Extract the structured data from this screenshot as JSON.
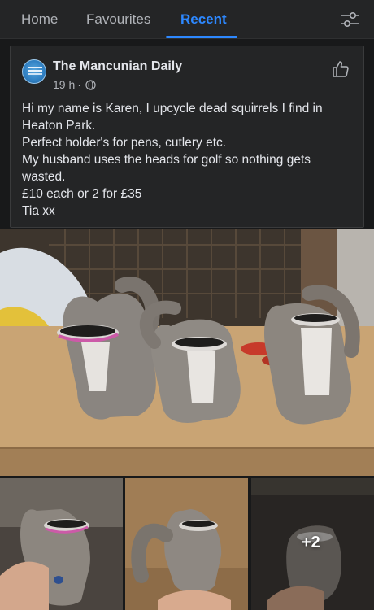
{
  "tabs": [
    {
      "label": "Home",
      "active": false
    },
    {
      "label": "Favourites",
      "active": false
    },
    {
      "label": "Recent",
      "active": true
    }
  ],
  "post": {
    "page_name": "The Mancunian Daily",
    "time": "19 h",
    "separator": "·",
    "text_lines": [
      "Hi my name is Karen, I upcycle dead squirrels I find in",
      "Heaton Park.",
      "Perfect holder's for pens, cutlery etc.",
      "My husband uses the heads for golf so nothing gets",
      "wasted.",
      "£10 each or 2 for £35",
      "Tia xx"
    ],
    "more_photos": "+2"
  },
  "icons": {
    "filter": "filter-sliders-icon",
    "like": "thumbs-up-icon",
    "audience": "globe-icon"
  },
  "colors": {
    "background": "#18191a",
    "card": "#242526",
    "accent": "#2d88ff",
    "text": "#e4e6eb",
    "muted": "#b0b3b8"
  }
}
